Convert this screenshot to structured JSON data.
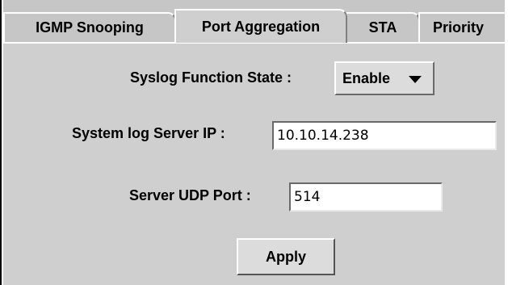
{
  "tabs": [
    {
      "label": "IGMP Snooping"
    },
    {
      "label": "Port Aggregation"
    },
    {
      "label": "STA"
    },
    {
      "label": "Priority"
    }
  ],
  "syslog": {
    "state_label": "Syslog Function State :",
    "state_value": "Enable",
    "server_ip_label": "System log Server IP :",
    "server_ip_value": "10.10.14.238",
    "udp_port_label": "Server UDP Port :",
    "udp_port_value": "514",
    "apply_label": "Apply"
  }
}
